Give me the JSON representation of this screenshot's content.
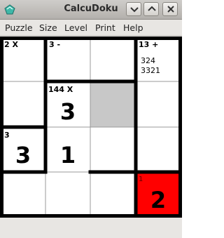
{
  "window": {
    "title": "CalcuDoku"
  },
  "menu": [
    "Puzzle",
    "Size",
    "Level",
    "Print",
    "Help"
  ],
  "board": {
    "size": 4,
    "cages": [
      {
        "clue": "2 X"
      },
      {
        "clue": "3 -"
      },
      {
        "clue": "13 +",
        "pencil_marks": [
          "324",
          "3321"
        ]
      },
      {
        "clue": "144 X"
      },
      {
        "clue": "3"
      },
      {
        "clue": "1"
      }
    ],
    "values": [
      {
        "row": 2,
        "col": 2,
        "value": "3"
      },
      {
        "row": 3,
        "col": 1,
        "value": "3"
      },
      {
        "row": 3,
        "col": 2,
        "value": "1"
      },
      {
        "row": 4,
        "col": 4,
        "value": "2"
      }
    ],
    "selected_cell": {
      "row": 2,
      "col": 3
    },
    "error_cell": {
      "row": 4,
      "col": 4
    },
    "colors": {
      "selected": "#c8c8c8",
      "error": "#ff0000",
      "grid": "#000000"
    }
  }
}
